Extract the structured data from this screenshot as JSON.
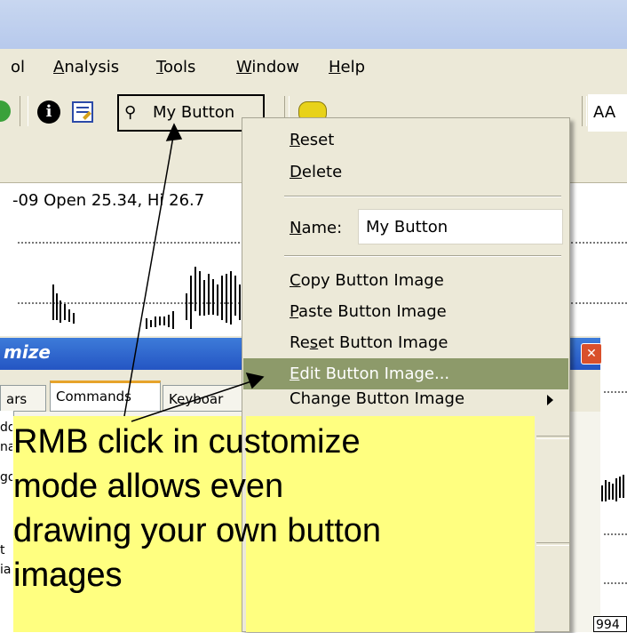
{
  "menubar": {
    "items": [
      {
        "label": "ol",
        "mnemonic": ""
      },
      {
        "label": "Analysis",
        "mnemonic": "A"
      },
      {
        "label": "Tools",
        "mnemonic": "T"
      },
      {
        "label": "Window",
        "mnemonic": "W"
      },
      {
        "label": "Help",
        "mnemonic": "H"
      }
    ]
  },
  "toolbar": {
    "my_button_label": "My Button",
    "aa_label": "AA"
  },
  "chart": {
    "info_text": "-09 Open 25.34, Hi 26.7",
    "right_label": "994"
  },
  "customize_dialog": {
    "title": "mize",
    "tabs": [
      "ars",
      "Commands",
      "Keyboar"
    ],
    "left_fragments": [
      "dd",
      "na",
      "go",
      "t",
      "ia"
    ]
  },
  "context_menu": {
    "reset": "Reset",
    "delete": "Delete",
    "name_label": "Name:",
    "name_value": "My Button",
    "copy_image": "Copy Button Image",
    "paste_image": "Paste Button Image",
    "reset_image": "Reset Button Image",
    "edit_image": "Edit Button Image..."
  },
  "callout": {
    "text_line1": "RMB click in customize",
    "text_line2": "mode allows even",
    "text_line3": "drawing your own button",
    "text_line4": "images"
  },
  "colors": {
    "menu_bg": "#ece9d8",
    "highlight": "#8d9a6a",
    "callout_bg": "#ffff80",
    "title_blue": "#2455c3"
  }
}
